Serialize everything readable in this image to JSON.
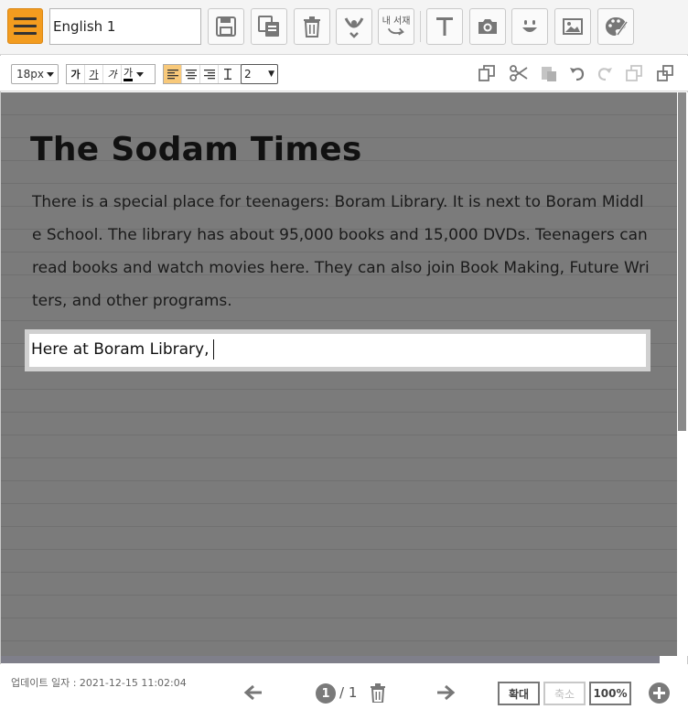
{
  "toolbar": {
    "title_value": "English 1",
    "buttons": [
      {
        "icon": "save-icon"
      },
      {
        "icon": "copy-pages-icon"
      },
      {
        "icon": "trash-icon"
      },
      {
        "icon": "submit-icon"
      },
      {
        "icon": "my-bookshelf-icon",
        "label": "내 서재"
      },
      {
        "icon": "text-icon"
      },
      {
        "icon": "camera-icon"
      },
      {
        "icon": "emoji-icon"
      },
      {
        "icon": "image-icon"
      },
      {
        "icon": "palette-icon"
      }
    ],
    "accent": "#f39c1f"
  },
  "format": {
    "font_size": "18px",
    "styles": [
      "가",
      "가",
      "가",
      "가"
    ],
    "align": [
      "left",
      "center",
      "right",
      "justify"
    ],
    "active_align": "left",
    "line_spacing": "2"
  },
  "document": {
    "title": "The Sodam Times",
    "body": "There is a special place for teenagers: Boram Library. It is next to Boram Middle School. The library has about 95,000 books and 15,000 DVDs. Teenagers can read books and watch movies here. They can also join Book Making, Future Writers, and other programs.",
    "editing_text": "Here at Boram Library,"
  },
  "footer": {
    "updated": "업데이트 일자 : 2021-12-15 11:02:04",
    "current_page": "1",
    "total_pages": "/ 1",
    "zoom_in": "확대",
    "zoom_out": "축소",
    "zoom_level": "100%"
  }
}
